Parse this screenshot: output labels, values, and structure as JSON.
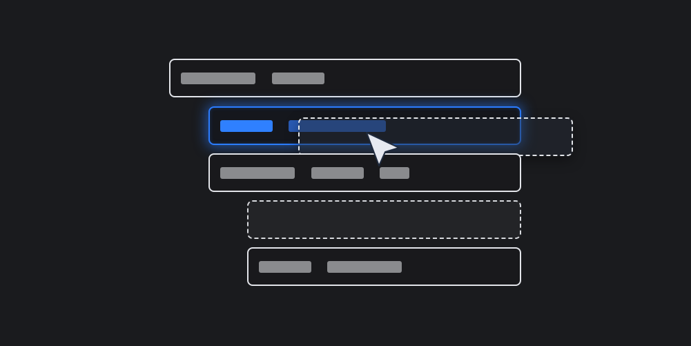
{
  "colors": {
    "background": "#1a1b1e",
    "row_border": "#e3e5ea",
    "selected_border": "#2b7cff",
    "text_placeholder": "#8a8b8e",
    "accent": "#2f80ff"
  },
  "list": {
    "items": [
      {
        "state": "idle"
      },
      {
        "state": "selected"
      },
      {
        "state": "idle"
      },
      {
        "state": "drop-target"
      },
      {
        "state": "idle"
      }
    ]
  },
  "drag": {
    "ghost_visible": true,
    "cursor_icon": "pointer-arrow-icon"
  }
}
